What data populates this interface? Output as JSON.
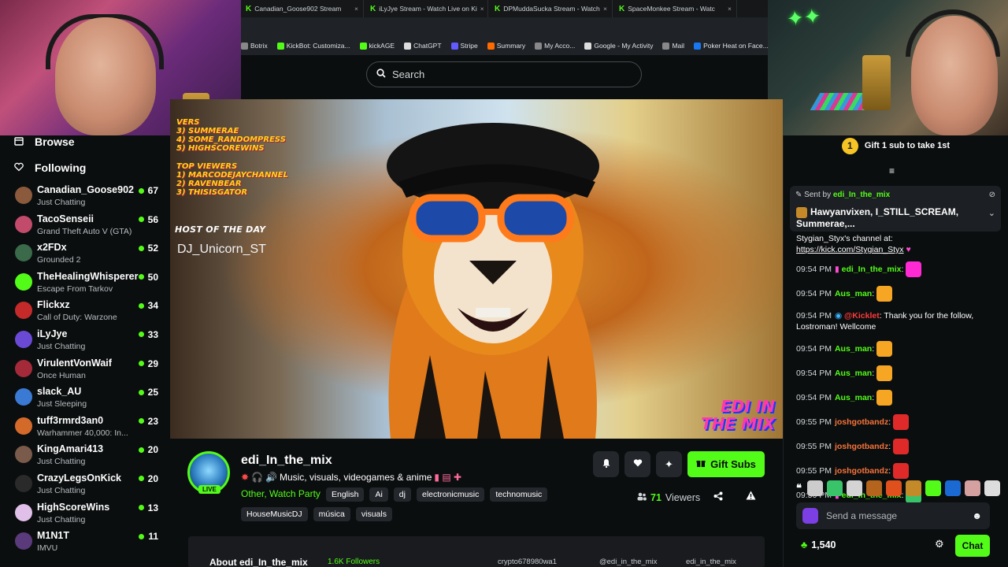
{
  "browser": {
    "tabs": [
      {
        "label": "Canadian_Goose902 Stream"
      },
      {
        "label": "iLyJye Stream - Watch Live on Ki"
      },
      {
        "label": "DPMuddaSucka Stream - Watch"
      },
      {
        "label": "SpaceMonkee Stream - Watc"
      }
    ],
    "bookmarks": [
      {
        "label": "Botrix",
        "color": "#888888"
      },
      {
        "label": "KickBot: Customiza...",
        "color": "#53fc18"
      },
      {
        "label": "kickAGE",
        "color": "#53fc18"
      },
      {
        "label": "ChatGPT",
        "color": "#dddddd"
      },
      {
        "label": "Stripe",
        "color": "#635bff"
      },
      {
        "label": "Summary",
        "color": "#ff6a00"
      },
      {
        "label": "My Acco...",
        "color": "#888888"
      },
      {
        "label": "Google - My Activity",
        "color": "#dddddd"
      },
      {
        "label": "Mail",
        "color": "#888888"
      },
      {
        "label": "Poker Heat on Face...",
        "color": "#1877f2"
      }
    ]
  },
  "search": {
    "placeholder": "Search"
  },
  "sidebar": {
    "browse": "Browse",
    "following": "Following",
    "channels": [
      {
        "name": "Canadian_Goose902",
        "category": "Just Chatting",
        "viewers": "67",
        "color": "#8b5a3c"
      },
      {
        "name": "TacoSenseii",
        "category": "Grand Theft Auto V (GTA)",
        "viewers": "56",
        "color": "#c24a6a"
      },
      {
        "name": "x2FDx",
        "category": "Grounded 2",
        "viewers": "52",
        "color": "#3a6a4a"
      },
      {
        "name": "TheHealingWhisperer",
        "category": "Escape From Tarkov",
        "viewers": "50",
        "color": "#53fc18"
      },
      {
        "name": "Flickxz",
        "category": "Call of Duty: Warzone",
        "viewers": "34",
        "color": "#c42a2a"
      },
      {
        "name": "iLyJye",
        "category": "Just Chatting",
        "viewers": "33",
        "color": "#6a4ad4"
      },
      {
        "name": "VirulentVonWaif",
        "category": "Once Human",
        "viewers": "29",
        "color": "#a42a3a"
      },
      {
        "name": "slack_AU",
        "category": "Just Sleeping",
        "viewers": "25",
        "color": "#3a7ad4"
      },
      {
        "name": "tuff3rmrd3an0",
        "category": "Warhammer 40,000: In...",
        "viewers": "23",
        "color": "#d46a2a"
      },
      {
        "name": "KingAmari413",
        "category": "Just Chatting",
        "viewers": "20",
        "color": "#7a5a4a"
      },
      {
        "name": "CrazyLegsOnKick",
        "category": "Just Chatting",
        "viewers": "20",
        "color": "#2a2a2a"
      },
      {
        "name": "HighScoreWins",
        "category": "Just Chatting",
        "viewers": "13",
        "color": "#e0c0e8"
      },
      {
        "name": "M1N1T",
        "category": "IMVU",
        "viewers": "11",
        "color": "#5a3a7a"
      }
    ]
  },
  "player": {
    "overlay_top": [
      "VERS",
      "3) SUMMERAE",
      "4) SOME_RANDOMPRESS",
      "5) HIGHSCOREWINS"
    ],
    "top_viewers_label": "TOP VIEWERS",
    "top_viewers": [
      "1) MARCODEJAYCHANNEL",
      "2) RAVENBEAR",
      "3) THISISGATOR"
    ],
    "host_label": "HOST OF THE DAY",
    "host_name": "DJ_Unicorn_ST",
    "logo_line1": "EDI IN",
    "logo_line2": "THE MIX"
  },
  "stream": {
    "live": "LIVE",
    "name": "edi_In_the_mix",
    "title": "Music,  visuals, videogames & anime",
    "categories": "Other, Watch Party",
    "tags_row1": [
      "English",
      "Ai",
      "dj",
      "electronicmusic",
      "technomusic"
    ],
    "tags_row2": [
      "HouseMusicDJ",
      "música",
      "visuals"
    ],
    "gift_label": "Gift Subs",
    "viewers": "71",
    "viewers_label": "Viewers",
    "about": "About edi_In_the_mix",
    "followers": "1.6K Followers",
    "socials": [
      "crypto678980wa1",
      "@edi_in_the_mix",
      "edi_in_the_mix"
    ]
  },
  "chat": {
    "gift_num": "1",
    "gift_text": "Gift 1 sub to take 1st",
    "pin_by_label": "Sent by",
    "pin_by_user": "edi_In_the_mix",
    "pin_text": "Hawyanvixen, I_STILL_SCREAM, Summerae,...",
    "partial_line": "Stygian_Styx's channel at:",
    "partial_link": "https://kick.com/Stygian_Styx",
    "messages": [
      {
        "ts": "09:54 PM",
        "user": "edi_In_the_mix",
        "color": "#53fc18",
        "text": ":",
        "emote": "#ff2ad4"
      },
      {
        "ts": "09:54 PM",
        "user": "Aus_man",
        "color": "#53fc18",
        "text": ":",
        "emote": "#f6a623"
      },
      {
        "ts": "09:54 PM",
        "user": "@Kicklet",
        "color": "#ff3a3a",
        "text": ": Thank you for the follow, Lostroman! Wellcome",
        "emote": ""
      },
      {
        "ts": "09:54 PM",
        "user": "Aus_man",
        "color": "#53fc18",
        "text": ":",
        "emote": "#f6a623"
      },
      {
        "ts": "09:54 PM",
        "user": "Aus_man",
        "color": "#53fc18",
        "text": ":",
        "emote": "#f6a623"
      },
      {
        "ts": "09:54 PM",
        "user": "Aus_man",
        "color": "#53fc18",
        "text": ":",
        "emote": "#f6a623"
      },
      {
        "ts": "09:55 PM",
        "user": "joshgotbandz",
        "color": "#f6733a",
        "text": ":",
        "emote": "#e02a2a"
      },
      {
        "ts": "09:55 PM",
        "user": "joshgotbandz",
        "color": "#f6733a",
        "text": ":",
        "emote": "#e02a2a"
      },
      {
        "ts": "09:55 PM",
        "user": "joshgotbandz",
        "color": "#f6733a",
        "text": ":",
        "emote": "#e02a2a"
      },
      {
        "ts": "09:56 PM",
        "user": "edi_In_the_mix",
        "color": "#53fc18",
        "text": ":",
        "emote": "#3ac46a"
      }
    ],
    "emotes": [
      "#cccccc",
      "#3ac46a",
      "#d4d4d4",
      "#b4641c",
      "#e0501c",
      "#c48a2a",
      "#53fc18",
      "#1b6ad4",
      "#d4a0a0",
      "#dddddd"
    ],
    "placeholder": "Send a message",
    "points": "1,540",
    "chat_button": "Chat"
  }
}
